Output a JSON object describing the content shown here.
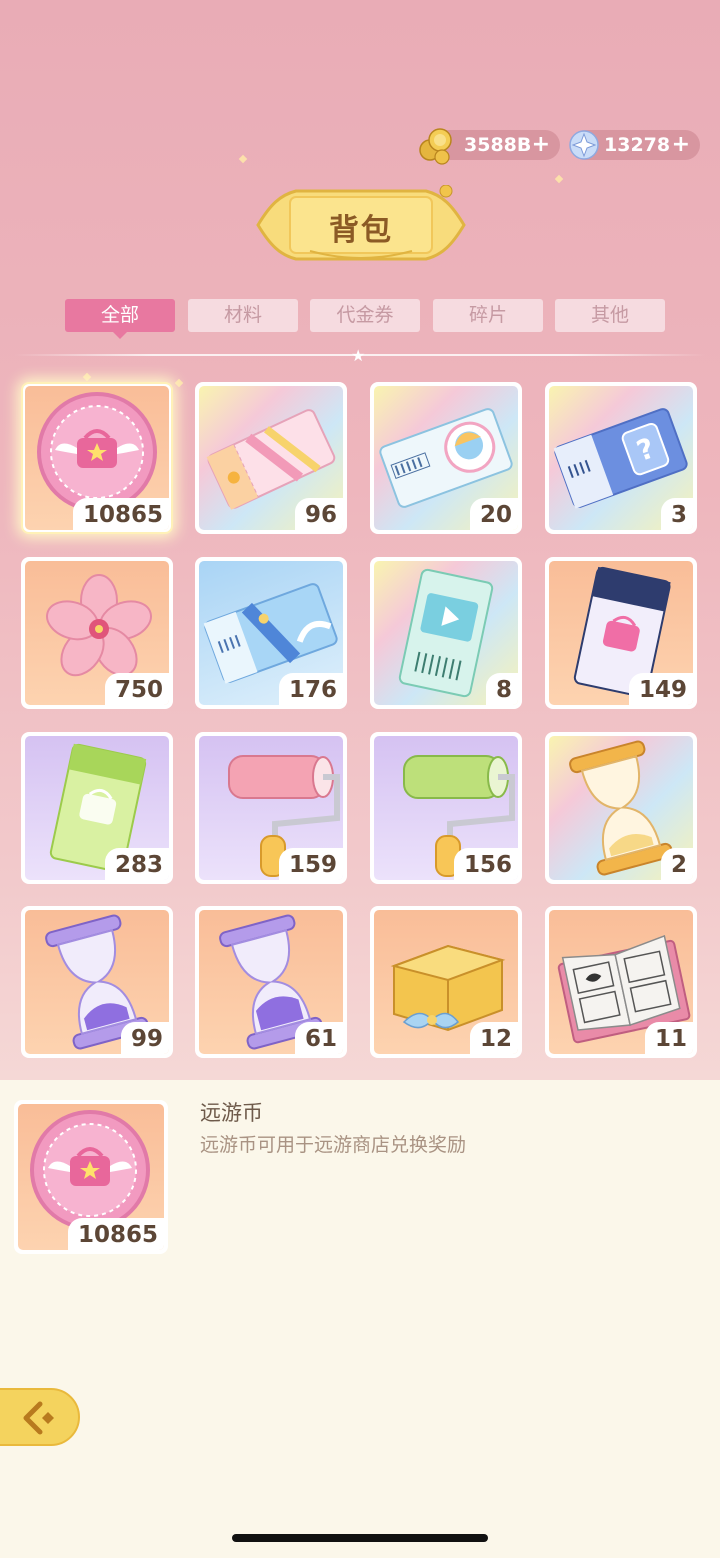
{
  "currency": {
    "coins": "3588B",
    "gems": "13278",
    "add_symbol": "+"
  },
  "title": "背包",
  "tabs": [
    "全部",
    "材料",
    "代金券",
    "碎片",
    "其他"
  ],
  "active_tab": "全部",
  "items": [
    {
      "name": "远游币",
      "icon": "travel-coin-icon",
      "count": "10865",
      "bg": "orange",
      "selected": true
    },
    {
      "name": "",
      "icon": "pink-ticket-icon",
      "count": "96",
      "bg": "rainbow"
    },
    {
      "name": "",
      "icon": "avatar-ticket-icon",
      "count": "20",
      "bg": "rainbow"
    },
    {
      "name": "",
      "icon": "mystery-ticket-icon",
      "count": "3",
      "bg": "rainbow"
    },
    {
      "name": "",
      "icon": "sakura-flower-icon",
      "count": "750",
      "bg": "orange"
    },
    {
      "name": "",
      "icon": "blue-ticket-icon",
      "count": "176",
      "bg": "blue"
    },
    {
      "name": "",
      "icon": "video-ticket-icon",
      "count": "8",
      "bg": "rainbow"
    },
    {
      "name": "",
      "icon": "dark-bag-ticket-icon",
      "count": "149",
      "bg": "orange"
    },
    {
      "name": "",
      "icon": "green-bag-ticket-icon",
      "count": "283",
      "bg": "purple"
    },
    {
      "name": "",
      "icon": "pink-paint-roller-icon",
      "count": "159",
      "bg": "purple"
    },
    {
      "name": "",
      "icon": "green-paint-roller-icon",
      "count": "156",
      "bg": "purple"
    },
    {
      "name": "",
      "icon": "gold-hourglass-icon",
      "count": "2",
      "bg": "rainbow"
    },
    {
      "name": "",
      "icon": "purple-hourglass-icon",
      "count": "99",
      "bg": "orange"
    },
    {
      "name": "",
      "icon": "purple-hourglass-icon",
      "count": "61",
      "bg": "orange"
    },
    {
      "name": "",
      "icon": "gift-box-icon",
      "count": "12",
      "bg": "orange"
    },
    {
      "name": "",
      "icon": "manga-book-icon",
      "count": "11",
      "bg": "orange"
    }
  ],
  "detail": {
    "name": "远游币",
    "description": "远游币可用于远游商店兑换奖励",
    "count": "10865",
    "icon": "travel-coin-icon"
  },
  "back_icon": "back-arrow-icon"
}
